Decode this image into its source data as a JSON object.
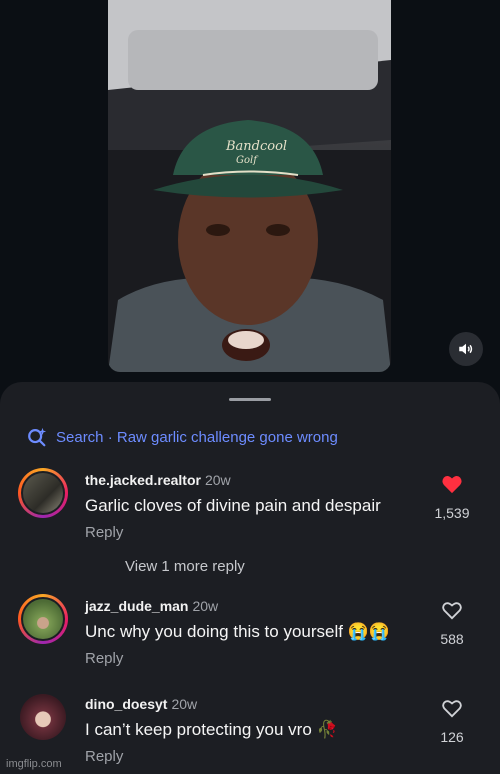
{
  "video": {
    "mute_icon": "speaker-icon"
  },
  "search": {
    "label": "Search · Raw garlic challenge gone wrong",
    "icon": "sparkle-search-icon"
  },
  "comments": [
    {
      "username": "the.jacked.realtor",
      "time": "20w",
      "text": "Garlic cloves of divine pain and despair",
      "reply": "Reply",
      "likes": "1,539",
      "liked": true,
      "view_more": "View 1 more reply"
    },
    {
      "username": "jazz_dude_man",
      "time": "20w",
      "text": "Unc why you doing this to yourself 😭😭",
      "reply": "Reply",
      "likes": "588",
      "liked": false
    },
    {
      "username": "dino_doesyt",
      "time": "20w",
      "text": "I can’t keep protecting you vro 🥀",
      "reply": "Reply",
      "likes": "126",
      "liked": false
    }
  ],
  "colors": {
    "accent": "#6d8cff",
    "like_active": "#ff3040",
    "sheet_bg": "#1c1e23"
  },
  "watermark": "imgflip.com"
}
